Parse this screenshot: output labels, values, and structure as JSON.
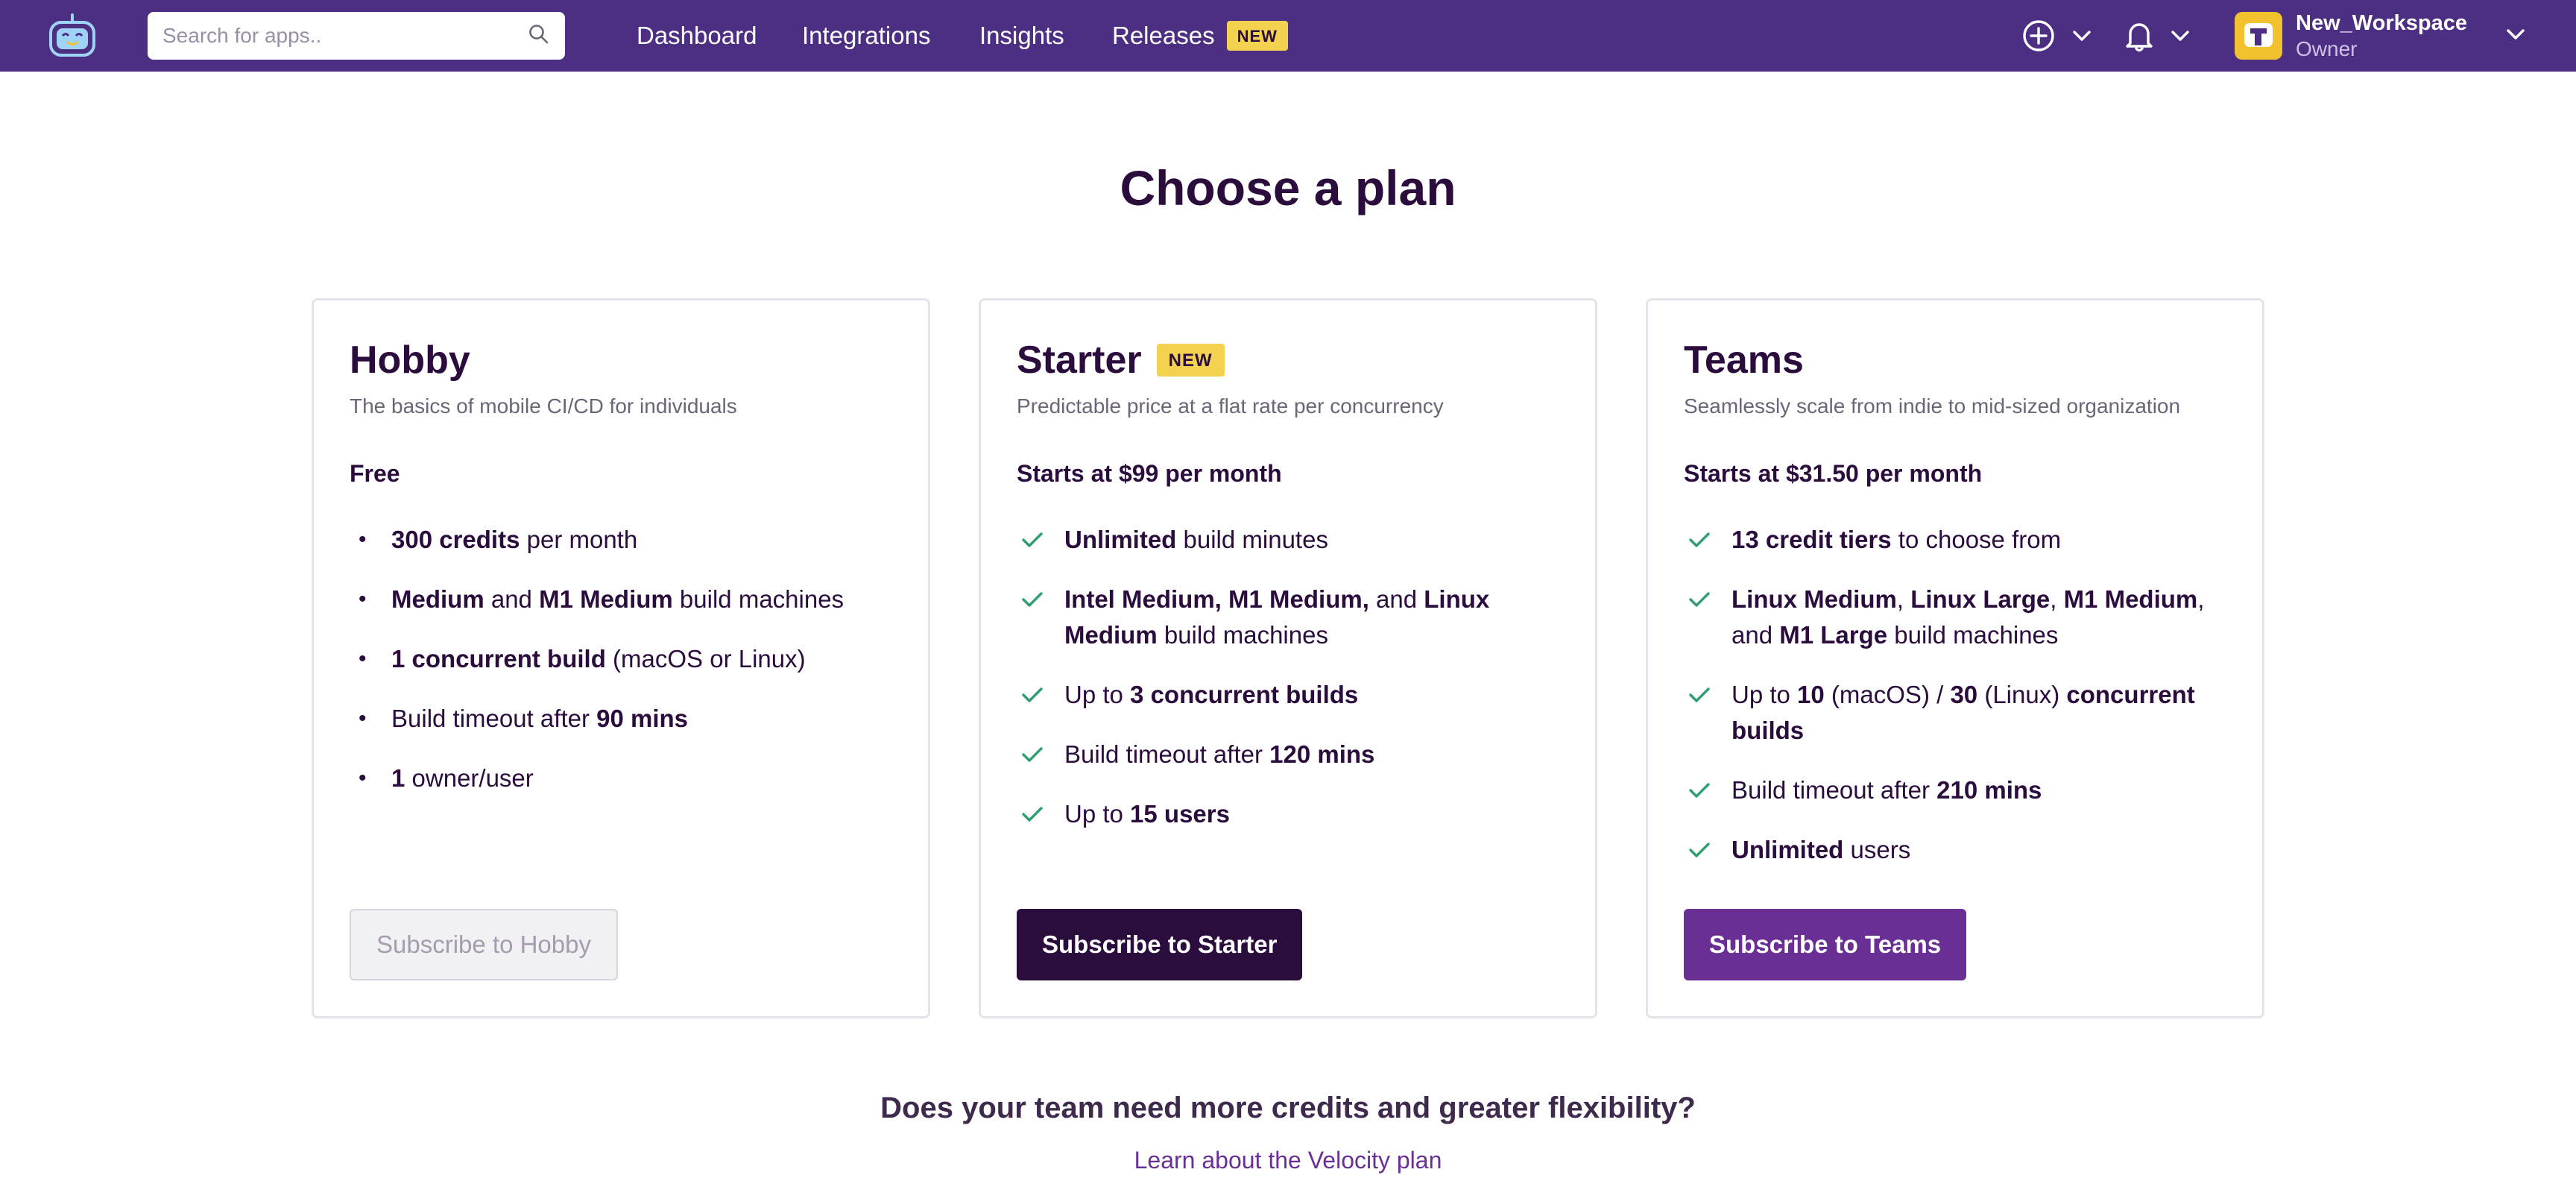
{
  "nav": {
    "search_placeholder": "Search for apps..",
    "links": [
      "Dashboard",
      "Integrations",
      "Insights",
      "Releases"
    ],
    "releases_badge": "NEW",
    "workspace_name": "New_Workspace",
    "workspace_role": "Owner",
    "icons": [
      "app-logo-icon",
      "search-icon",
      "add-circle-icon",
      "chevron-down-icon",
      "bell-icon",
      "chevron-down-icon",
      "workspace-avatar-icon",
      "chevron-down-icon"
    ],
    "colors": {
      "bar": "#4c2f83",
      "badge": "#f2d24f"
    }
  },
  "page": {
    "title": "Choose a plan",
    "more_question": "Does your team need more credits and greater flexibility?",
    "more_link": "Learn about the Velocity plan"
  },
  "plans": [
    {
      "name": "Hobby",
      "description": "The basics of mobile CI/CD for individuals",
      "price": "Free",
      "features": [
        [
          {
            "b": "300 credits"
          },
          {
            "t": " per month"
          }
        ],
        [
          {
            "b": "Medium"
          },
          {
            "t": " and "
          },
          {
            "b": "M1 Medium"
          },
          {
            "t": " build machines"
          }
        ],
        [
          {
            "b": "1 concurrent build"
          },
          {
            "t": " (macOS or Linux)"
          }
        ],
        [
          {
            "t": "Build timeout after "
          },
          {
            "b": "90 mins"
          }
        ],
        [
          {
            "b": "1"
          },
          {
            "t": " owner/user"
          }
        ]
      ],
      "button": "Subscribe to Hobby"
    },
    {
      "name": "Starter",
      "badge": "NEW",
      "description": "Predictable price at a flat rate per concurrency",
      "price": "Starts at $99 per month",
      "features": [
        [
          {
            "b": "Unlimited"
          },
          {
            "t": " build minutes"
          }
        ],
        [
          {
            "b": "Intel Medium, M1 Medium,"
          },
          {
            "t": " and "
          },
          {
            "b": "Linux Medium"
          },
          {
            "t": " build machines"
          }
        ],
        [
          {
            "t": "Up to "
          },
          {
            "b": "3 concurrent builds"
          }
        ],
        [
          {
            "t": "Build timeout after "
          },
          {
            "b": "120 mins"
          }
        ],
        [
          {
            "t": "Up to "
          },
          {
            "b": "15 users"
          }
        ]
      ],
      "button": "Subscribe to Starter"
    },
    {
      "name": "Teams",
      "description": "Seamlessly scale from indie to mid-sized organization",
      "price": "Starts at $31.50 per month",
      "features": [
        [
          {
            "b": "13 credit tiers"
          },
          {
            "t": " to choose from"
          }
        ],
        [
          {
            "b": "Linux Medium"
          },
          {
            "t": ", "
          },
          {
            "b": "Linux Large"
          },
          {
            "t": ", "
          },
          {
            "b": "M1 Medium"
          },
          {
            "t": ", and "
          },
          {
            "b": "M1 Large"
          },
          {
            "t": " build machines"
          }
        ],
        [
          {
            "t": "Up to "
          },
          {
            "b": "10"
          },
          {
            "t": " (macOS) / "
          },
          {
            "b": "30"
          },
          {
            "t": " (Linux) "
          },
          {
            "b": "concurrent builds"
          }
        ],
        [
          {
            "t": "Build timeout after "
          },
          {
            "b": "210 mins"
          }
        ],
        [
          {
            "b": "Unlimited"
          },
          {
            "t": " users"
          }
        ]
      ],
      "button": "Subscribe to Teams"
    }
  ]
}
